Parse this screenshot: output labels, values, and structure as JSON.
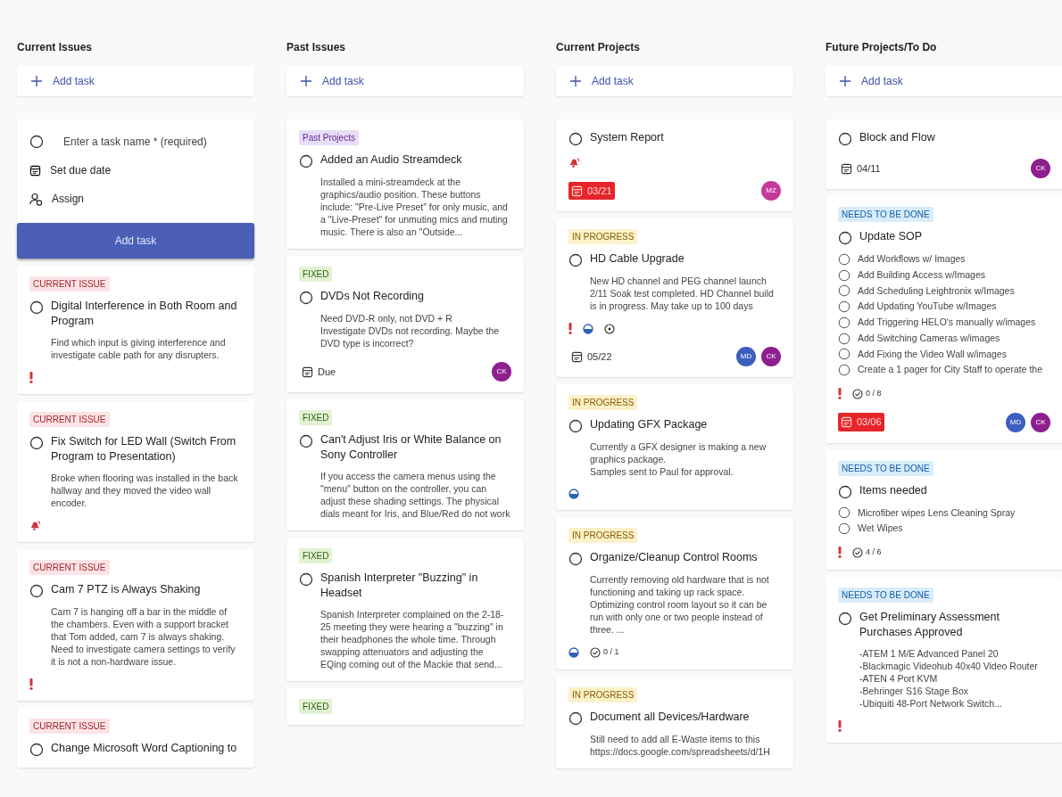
{
  "columns": [
    {
      "title": "Current Issues",
      "add_label": "Add task",
      "cards": [
        {
          "kind": "form",
          "placeholder": "Enter a task name * (required)",
          "due_label": "Set due date",
          "assign_label": "Assign",
          "submit_label": "Add task"
        },
        {
          "kind": "task",
          "tag": {
            "label": "CURRENT ISSUE",
            "color": "#fbe3e6"
          },
          "title": "Digital Interference in Both Room and Program",
          "description": "Find which input is giving interference and investigate cable path for any disrupters.",
          "important": true
        },
        {
          "kind": "task",
          "tag": {
            "label": "CURRENT ISSUE",
            "color": "#fbe3e6"
          },
          "title": "Fix Switch for LED Wall (Switch From Program to Presentation)",
          "description": "Broke when flooring was installed in the back hallway and they moved the video wall encoder.",
          "urgent": true
        },
        {
          "kind": "task",
          "tag": {
            "label": "CURRENT ISSUE",
            "color": "#fbe3e6"
          },
          "title": "Cam 7 PTZ is Always Shaking",
          "description": "Cam 7 is hanging off a bar in the middle of the chambers. Even with a support bracket that Tom added, cam 7 is always shaking. Need to investigate camera settings to verify it is not a non-hardware issue.",
          "important": true
        },
        {
          "kind": "task",
          "tag": {
            "label": "CURRENT ISSUE",
            "color": "#fbe3e6"
          },
          "title": "Change Microsoft Word Captioning to"
        }
      ]
    },
    {
      "title": "Past Issues",
      "add_label": "Add task",
      "cards": [
        {
          "kind": "task",
          "tag": {
            "label": "Past Projects",
            "color": "#e9dcf6"
          },
          "title": "Added an Audio Streamdeck",
          "description": "Installed a mini-streamdeck at the graphics/audio position. These buttons include: \"Pre-Live Preset\" for only music, and a \"Live-Preset\" for unmuting mics and muting music. There is also an \"Outside..."
        },
        {
          "kind": "task",
          "tag": {
            "label": "FIXED",
            "color": "#e2f2d3"
          },
          "title": "DVDs Not Recording",
          "description": "Need DVD-R only, not DVD + R\nInvestigate DVDs not recording. Maybe the DVD type is incorrect?",
          "due": {
            "label": "Due",
            "overdue": false
          },
          "assignees": [
            {
              "initials": "CK",
              "color": "#8e1f8e"
            }
          ]
        },
        {
          "kind": "task",
          "tag": {
            "label": "FIXED",
            "color": "#e2f2d3"
          },
          "title": "Can't Adjust Iris or White Balance on Sony Controller",
          "description": "If you access the camera menus using the \"menu\" button on the controller, you can adjust these shading settings. The physical dials meant for Iris, and Blue/Red do not work"
        },
        {
          "kind": "task",
          "tag": {
            "label": "FIXED",
            "color": "#e2f2d3"
          },
          "title": "Spanish Interpreter \"Buzzing\" in Headset",
          "description": "Spanish Interpreter complained on the 2-18-25 meeting they were hearing a \"buzzing\" in their headphones the whole time. Through swapping attenuators and adjusting the EQing coming out of the Mackie that send..."
        },
        {
          "kind": "task",
          "tag": {
            "label": "FIXED",
            "color": "#e2f2d3"
          }
        }
      ]
    },
    {
      "title": "Current Projects",
      "add_label": "Add task",
      "cards": [
        {
          "kind": "task",
          "title": "System Report",
          "urgent": true,
          "due": {
            "label": "03/21",
            "overdue": true
          },
          "assignees": [
            {
              "initials": "MZ",
              "color": "#c43a9c"
            }
          ]
        },
        {
          "kind": "task",
          "tag": {
            "label": "IN PROGRESS",
            "color": "#fdf1c9"
          },
          "title": "HD Cable Upgrade",
          "description": "New HD channel and PEG channel launch 2/11 Soak test completed. HD Channel build is in progress. May take up to 100 days",
          "important": true,
          "in_progress": true,
          "has_notes": true,
          "due": {
            "label": "05/22",
            "overdue": false
          },
          "assignees": [
            {
              "initials": "MD",
              "color": "#3c5fbf"
            },
            {
              "initials": "CK",
              "color": "#8e1f8e"
            }
          ]
        },
        {
          "kind": "task",
          "tag": {
            "label": "IN PROGRESS",
            "color": "#fdf1c9"
          },
          "title": "Updating GFX Package",
          "description": "Currently a GFX designer is making a new graphics package.\nSamples sent to Paul for approval.",
          "in_progress": true
        },
        {
          "kind": "task",
          "tag": {
            "label": "IN PROGRESS",
            "color": "#fdf1c9"
          },
          "title": "Organize/Cleanup Control Rooms",
          "description": "Currently removing old hardware that is not functioning and taking up rack space. Optimizing control room layout so it can be run with only one or two people instead of three. ...",
          "in_progress": true,
          "checklist_count": "0 / 1"
        },
        {
          "kind": "task",
          "tag": {
            "label": "IN PROGRESS",
            "color": "#fdf1c9"
          },
          "title": "Document all Devices/Hardware",
          "description": "Still need to add all E-Waste items to this\nhttps://docs.google.com/spreadsheets/d/1H"
        }
      ]
    },
    {
      "title": "Future Projects/To Do",
      "add_label": "Add task",
      "cards": [
        {
          "kind": "task",
          "title": "Block and Flow",
          "due": {
            "label": "04/11",
            "overdue": false
          },
          "assignees": [
            {
              "initials": "CK",
              "color": "#8e1f8e"
            }
          ]
        },
        {
          "kind": "task",
          "tag": {
            "label": "NEEDS TO BE DONE",
            "color": "#d9ecfa"
          },
          "title": "Update SOP",
          "checklist": [
            {
              "text": "Add Workflows w/ Images",
              "checked": false
            },
            {
              "text": "Add Building Access w/Images",
              "checked": false
            },
            {
              "text": "Add Scheduling Leightronix w/Images",
              "checked": false
            },
            {
              "text": "Add Updating YouTube w/Images",
              "checked": false
            },
            {
              "text": "Add Triggering HELO's manually w/images",
              "checked": false
            },
            {
              "text": "Add Switching Cameras w/images",
              "checked": false
            },
            {
              "text": "Add Fixing the Video Wall w/images",
              "checked": false
            },
            {
              "text": "Create a 1 pager for City Staff to operate the",
              "checked": false
            }
          ],
          "important": true,
          "checklist_count": "0 / 8",
          "due": {
            "label": "03/06",
            "overdue": true
          },
          "assignees": [
            {
              "initials": "MD",
              "color": "#3c5fbf"
            },
            {
              "initials": "CK",
              "color": "#8e1f8e"
            }
          ]
        },
        {
          "kind": "task",
          "tag": {
            "label": "NEEDS TO BE DONE",
            "color": "#d9ecfa"
          },
          "title": "Items needed",
          "checklist": [
            {
              "text": "Microfiber wipes Lens Cleaning Spray",
              "checked": false
            },
            {
              "text": "Wet Wipes",
              "checked": false
            }
          ],
          "important": true,
          "checklist_count": "4 / 6"
        },
        {
          "kind": "task",
          "tag": {
            "label": "NEEDS TO BE DONE",
            "color": "#d9ecfa"
          },
          "title": "Get Preliminary Assessment Purchases Approved",
          "description": "-ATEM 1 M/E Advanced Panel 20\n-Blackmagic Videohub 40x40 Video Router\n-ATEN 4 Port KVM\n-Behringer S16 Stage Box\n-Ubiquiti 48-Port Network Switch...",
          "important": true
        }
      ]
    }
  ]
}
